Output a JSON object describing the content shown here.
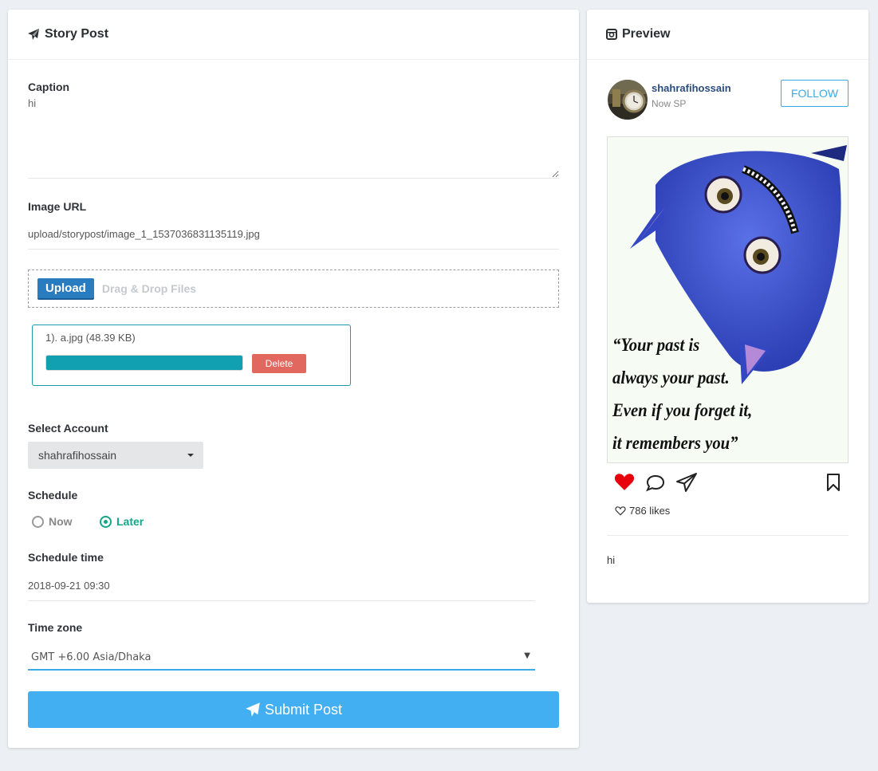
{
  "form": {
    "header_title": "Story Post",
    "caption_label": "Caption",
    "caption_value": "hi",
    "image_url_label": "Image URL",
    "image_url_value": "upload/storypost/image_1_1537036831135119.jpg",
    "upload_label": "Upload",
    "drop_text": "Drag & Drop Files",
    "file_item": "1). a.jpg (48.39 KB)",
    "upload_progress_fraction": 1.0,
    "delete_label": "Delete",
    "account_label": "Select Account",
    "account_value": "shahrafihossain",
    "schedule_label": "Schedule",
    "schedule_now": "Now",
    "schedule_later": "Later",
    "schedule_selected": "Later",
    "schedule_time_label": "Schedule time",
    "schedule_time_value": "2018-09-21 09:30",
    "timezone_label": "Time zone",
    "timezone_value": "GMT +6.00 Asia/Dhaka",
    "submit_label": "Submit Post"
  },
  "preview": {
    "header_title": "Preview",
    "username": "shahrafihossain",
    "subline": "Now SP",
    "follow_label": "FOLLOW",
    "image_quote": [
      "“Your past is",
      "always your past.",
      "Even if you forget it,",
      "it remembers you”"
    ],
    "likes": "786 likes",
    "caption": "hi",
    "icons": [
      "instagram-icon",
      "heart-icon",
      "comment-icon",
      "share-icon",
      "bookmark-icon",
      "heart-outline-icon"
    ]
  },
  "colors": {
    "accent_blue": "#41aff1",
    "upload_blue": "#2a7cc0",
    "progress_teal": "#10a0b1",
    "delete_red": "#e0685f",
    "radio_green": "#17a589",
    "like_red": "#e8000d"
  }
}
